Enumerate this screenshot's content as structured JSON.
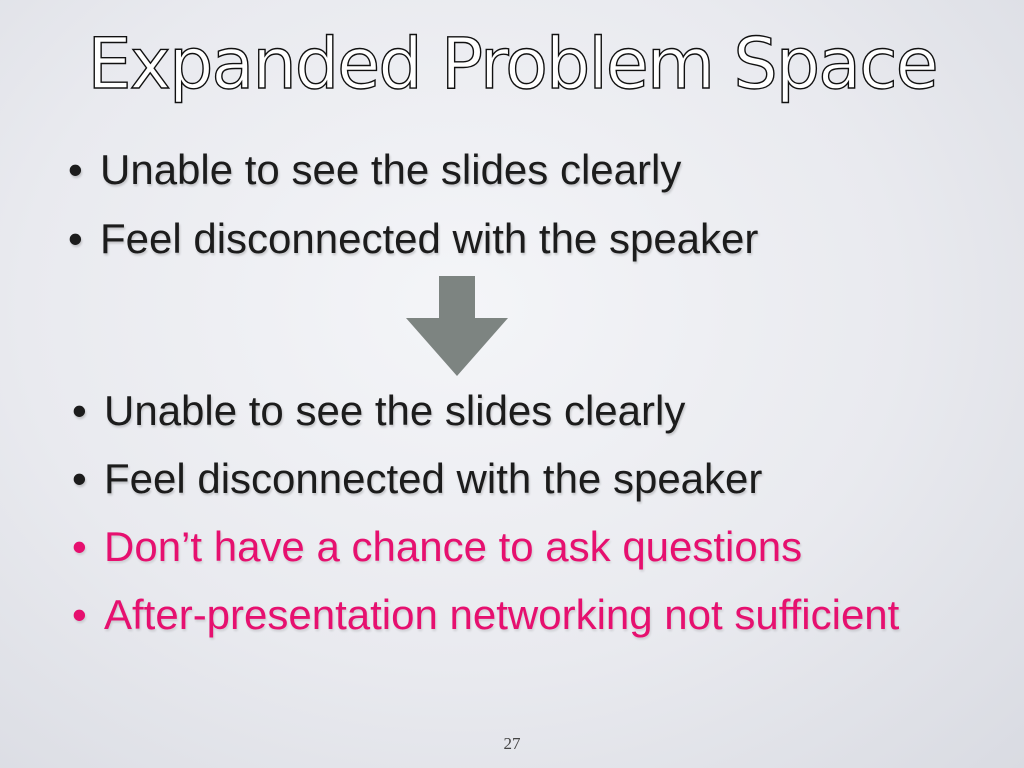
{
  "slide": {
    "title": "Expanded Problem Space",
    "bullet_glyph": "•",
    "list_before": [
      "Unable to see the slides clearly",
      "Feel disconnected with the speaker"
    ],
    "list_after": [
      "Unable to see the slides clearly",
      "Feel disconnected with the speaker",
      "Don’t have a chance to ask questions",
      "After-presentation networking not sufficient"
    ],
    "page_number": "27"
  },
  "icons": {
    "arrow": "arrow-down-icon"
  },
  "colors": {
    "text": "#1c1c1c",
    "accent": "#e6106f",
    "arrow": "#7d8481",
    "background": "#e9eaef"
  }
}
